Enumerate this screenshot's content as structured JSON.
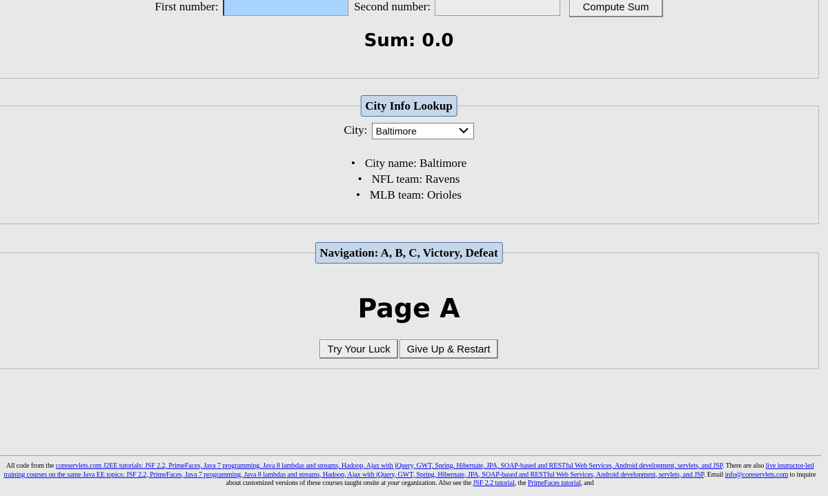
{
  "sum_panel": {
    "first_label": "First number:",
    "first_value": "",
    "second_label": "Second number:",
    "second_value": "",
    "compute_button": "Compute Sum",
    "result": "Sum: 0.0"
  },
  "city_panel": {
    "legend": "City Info Lookup",
    "city_label": "City:",
    "selected_city": "Baltimore",
    "info": [
      "City name: Baltimore",
      "NFL team: Ravens",
      "MLB team: Orioles"
    ]
  },
  "nav_panel": {
    "legend": "Navigation: A, B, C, Victory, Defeat",
    "heading": "Page A",
    "try_button": "Try Your Luck",
    "restart_button": "Give Up & Restart"
  },
  "footer": {
    "t1": "All code from the ",
    "l1": "coreservlets.com J2EE tutorials: JSF 2.2, PrimeFaces, Java 7 programming, Java 8 lambdas and streams, Hadoop, Ajax with jQuery, GWT, Spring, Hibernate, JPA, SOAP-based and RESTful Web Services, Android development, servlets, and JSP",
    "t2": ". There are also ",
    "l2": "live instructor-led training courses on the same Java EE topics: JSF 2.2, PrimeFaces, Java 7 programming, Java 8 lambdas and streams, Hadoop, Ajax with jQuery, GWT, Spring, Hibernate, JPA, SOAP-based and RESTful Web Services, Android development, servlets, and JSP",
    "t3": ". Email ",
    "l3": "info@coreservlets.com",
    "t4": " to inquire about customized versions of these courses taught onsite at ",
    "t5": "your",
    "t6": " organization. Also see the ",
    "l4": "JSF 2.2 tutorial",
    "t7": ", the ",
    "l5": "PrimeFaces tutorial",
    "t8": ", and"
  }
}
